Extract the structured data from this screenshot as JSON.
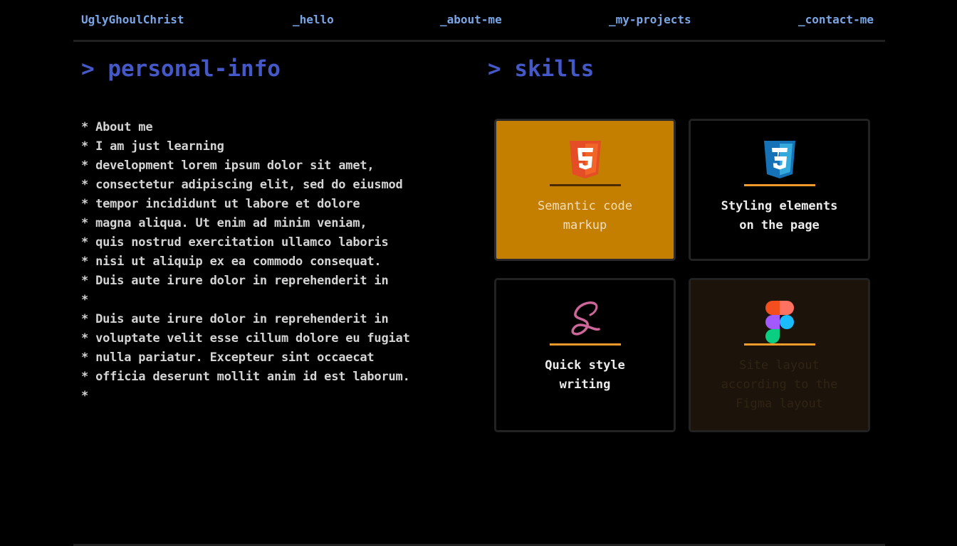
{
  "nav": {
    "logo": "UglyGhoulChrist",
    "links": [
      "_hello",
      "_about-me",
      "_my-projects",
      "_contact-me"
    ]
  },
  "personal_info": {
    "title": "> personal-info",
    "lines": [
      "* About me",
      "* I am just learning",
      "* development lorem ipsum dolor sit amet,",
      "* consectetur adipiscing elit, sed do eiusmod",
      "* tempor incididunt ut labore et dolore",
      "* magna aliqua. Ut enim ad minim veniam,",
      "* quis nostrud exercitation ullamco laboris",
      "* nisi ut aliquip ex ea commodo consequat.",
      "* Duis aute irure dolor in reprehenderit in",
      "*",
      "* Duis aute irure dolor in reprehenderit in",
      "* voluptate velit esse cillum dolore eu fugiat",
      "* nulla pariatur. Excepteur sint occaecat",
      "* officia deserunt mollit anim id est laborum.",
      "*"
    ]
  },
  "skills": {
    "title": "> skills",
    "cards": [
      {
        "icon": "html5-icon",
        "label_lines": [
          "Semantic code",
          "markup"
        ],
        "state": "active"
      },
      {
        "icon": "css3-icon",
        "label_lines": [
          "Styling elements",
          "on the page"
        ],
        "state": "normal"
      },
      {
        "icon": "sass-icon",
        "label_lines": [
          "Quick style",
          "writing"
        ],
        "state": "normal"
      },
      {
        "icon": "figma-icon",
        "label_lines": [
          "Site layout",
          "according to the",
          "Figma layout"
        ],
        "state": "dim"
      }
    ]
  },
  "colors": {
    "background": "#000000",
    "nav_link": "#7aa6e6",
    "section_title": "#4458c8",
    "body_text": "#d4d4d4",
    "active_card": "#c47e00",
    "accent_rule": "#f09a2a",
    "html5": "#e44d26",
    "css3": "#1572b6",
    "sass": "#cd6799"
  }
}
